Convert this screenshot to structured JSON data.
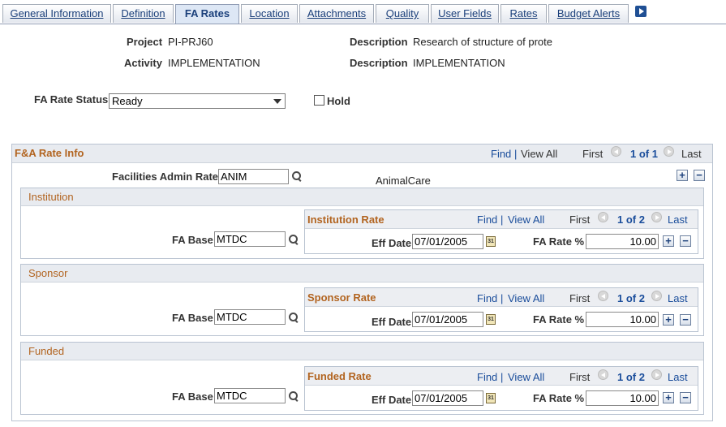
{
  "tabs": [
    {
      "label": "General Information",
      "active": false
    },
    {
      "label": "Definition",
      "active": false
    },
    {
      "label": "FA Rates",
      "active": true
    },
    {
      "label": "Location",
      "active": false
    },
    {
      "label": "Attachments",
      "active": false
    },
    {
      "label": "Quality",
      "active": false
    },
    {
      "label": "User Fields",
      "active": false
    },
    {
      "label": "Rates",
      "active": false
    },
    {
      "label": "Budget Alerts",
      "active": false
    }
  ],
  "header": {
    "project_label": "Project",
    "project_value": "PI-PRJ60",
    "project_desc_label": "Description",
    "project_desc_value": "Research of structure of prote",
    "activity_label": "Activity",
    "activity_value": "IMPLEMENTATION",
    "activity_desc_label": "Description",
    "activity_desc_value": "IMPLEMENTATION"
  },
  "status": {
    "label": "FA Rate Status",
    "selected": "Ready",
    "hold_label": "Hold",
    "hold_checked": false
  },
  "fa_rate_info": {
    "title": "F&A Rate Info",
    "find": "Find",
    "sep": "|",
    "view_all": "View All",
    "first": "First",
    "count": "1 of 1",
    "last": "Last",
    "facilities_label": "Facilities Admin Rate",
    "facilities_value": "ANIM",
    "facilities_desc": "AnimalCare",
    "add": "+",
    "remove": "−"
  },
  "sections": [
    {
      "title": "Institution",
      "fa_base_label": "FA Base",
      "fa_base_value": "MTDC",
      "rate_title": "Institution Rate",
      "find": "Find",
      "sep": "|",
      "view_all": "View All",
      "first": "First",
      "count": "1 of 2",
      "last": "Last",
      "eff_date_label": "Eff Date",
      "eff_date_value": "07/01/2005",
      "fa_rate_label": "FA Rate %",
      "fa_rate_value": "10.00",
      "cal": "31",
      "add": "+",
      "remove": "−"
    },
    {
      "title": "Sponsor",
      "fa_base_label": "FA Base",
      "fa_base_value": "MTDC",
      "rate_title": "Sponsor Rate",
      "find": "Find",
      "sep": "|",
      "view_all": "View All",
      "first": "First",
      "count": "1 of 2",
      "last": "Last",
      "eff_date_label": "Eff Date",
      "eff_date_value": "07/01/2005",
      "fa_rate_label": "FA Rate %",
      "fa_rate_value": "10.00",
      "cal": "31",
      "add": "+",
      "remove": "−"
    },
    {
      "title": "Funded",
      "fa_base_label": "FA Base",
      "fa_base_value": "MTDC",
      "rate_title": "Funded Rate",
      "find": "Find",
      "sep": "|",
      "view_all": "View All",
      "first": "First",
      "count": "1 of 2",
      "last": "Last",
      "eff_date_label": "Eff Date",
      "eff_date_value": "07/01/2005",
      "fa_rate_label": "FA Rate %",
      "fa_rate_value": "10.00",
      "cal": "31",
      "add": "+",
      "remove": "−"
    }
  ]
}
